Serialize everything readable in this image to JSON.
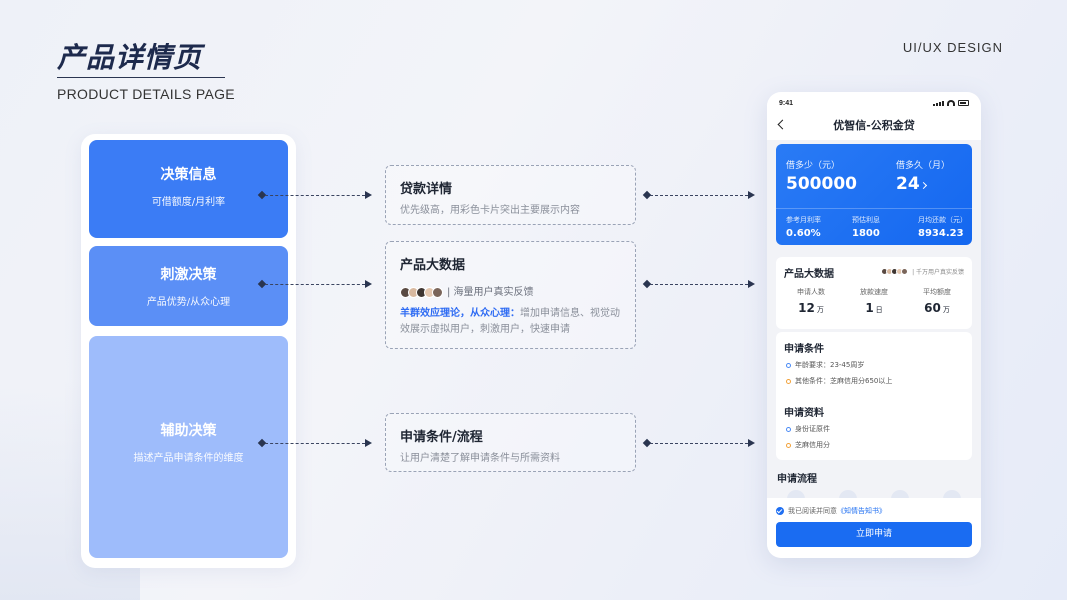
{
  "header": {
    "title": "产品详情页",
    "subtitle": "PRODUCT DETAILS PAGE",
    "brand": "UI/UX DESIGN"
  },
  "decisions": [
    {
      "title": "决策信息",
      "desc": "可借额度/月利率"
    },
    {
      "title": "刺激决策",
      "desc": "产品优势/从众心理"
    },
    {
      "title": "辅助决策",
      "desc": "描述产品申请条件的维度"
    }
  ],
  "info_boxes": {
    "loan_details": {
      "title": "贷款详情",
      "desc": "优先级高，用彩色卡片突出主要展示内容"
    },
    "big_data": {
      "title": "产品大数据",
      "users_text": "| 海量用户真实反馈",
      "theory_highlight": "羊群效应理论，从众心理：",
      "theory_text": "增加申请信息、视觉动效展示虚拟用户，刺激用户，快速申请"
    },
    "conditions": {
      "title": "申请条件/流程",
      "desc": "让用户清楚了解申请条件与所需资料"
    }
  },
  "phone": {
    "time": "9:41",
    "nav_title": "优智信-公积金贷",
    "loan_card": {
      "amount_label": "借多少（元）",
      "amount_value": "500000",
      "term_label": "借多久（月）",
      "term_value": "24",
      "rate_label": "参考月利率",
      "rate_value": "0.60%",
      "interest_label": "预估利息",
      "interest_value": "1800",
      "monthly_label": "月均还款（元）",
      "monthly_value": "8934.23"
    },
    "big_data": {
      "title": "产品大数据",
      "users_text": "| 千万用户真实反馈",
      "stats": [
        {
          "label": "申请人数",
          "value": "12",
          "unit": "万"
        },
        {
          "label": "放款速度",
          "value": "1",
          "unit": "日"
        },
        {
          "label": "平均额度",
          "value": "60",
          "unit": "万"
        }
      ]
    },
    "conditions": {
      "title": "申请条件",
      "items": [
        "年龄要求：23-45周岁",
        "其他条件：芝麻信用分650以上"
      ]
    },
    "materials": {
      "title": "申请资料",
      "items": [
        "身份证原件",
        "芝麻信用分"
      ]
    },
    "process_title": "申请流程",
    "agree_prefix": "我已阅读并同意",
    "agree_link": "《知情告知书》",
    "apply_button": "立即申请"
  },
  "colors": {
    "primary": "#1a6cf2",
    "card_1": "#3b7cf5",
    "card_2": "#5b8ff6",
    "card_3": "#9ebcfb",
    "title": "#1d2a4d"
  }
}
